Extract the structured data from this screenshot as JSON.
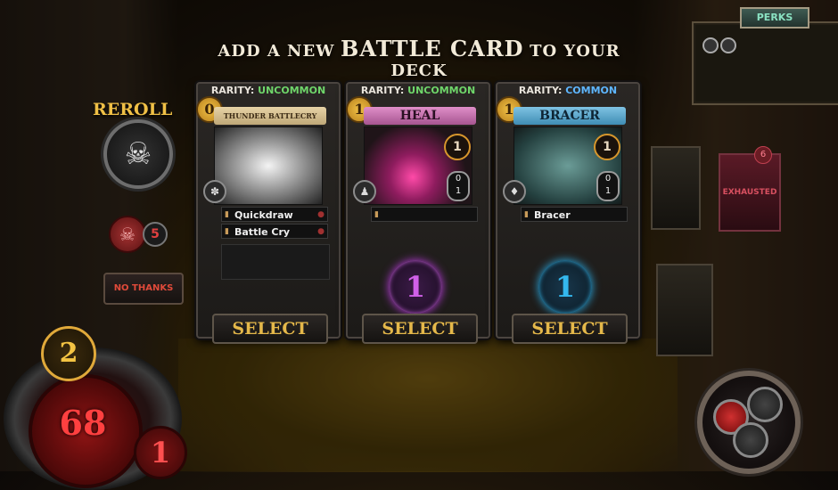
{
  "header": {
    "prefix": "ADD A NEW",
    "highlight": "BATTLE CARD",
    "suffix": "TO YOUR DECK"
  },
  "side": {
    "reroll_label": "REROLL",
    "skull_count": "5",
    "no_thanks_label": "NO THANKS"
  },
  "perks": {
    "label": "PERKS"
  },
  "cards": [
    {
      "rarity_label": "RARITY:",
      "rarity": "UNCOMMON",
      "cost": "0",
      "name": "THUNDER BATTLECRY",
      "abilities": [
        "Quickdraw",
        "Battle Cry"
      ],
      "select_label": "SELECT"
    },
    {
      "rarity_label": "RARITY:",
      "rarity": "UNCOMMON",
      "cost": "1",
      "name": "HEAL",
      "attack": "1",
      "stat_top": "0",
      "stat_bottom": "1",
      "mana": "1",
      "select_label": "SELECT"
    },
    {
      "rarity_label": "RARITY:",
      "rarity": "COMMON",
      "cost": "1",
      "name": "BRACER",
      "attack": "1",
      "stat_top": "0",
      "stat_bottom": "1",
      "abilities": [
        "Bracer"
      ],
      "mana": "1",
      "select_label": "SELECT"
    }
  ],
  "board": {
    "exhausted_label": "EXHAUSTED",
    "exhausted_count": "6"
  },
  "player": {
    "level": "2",
    "health": "68",
    "armor": "1"
  }
}
